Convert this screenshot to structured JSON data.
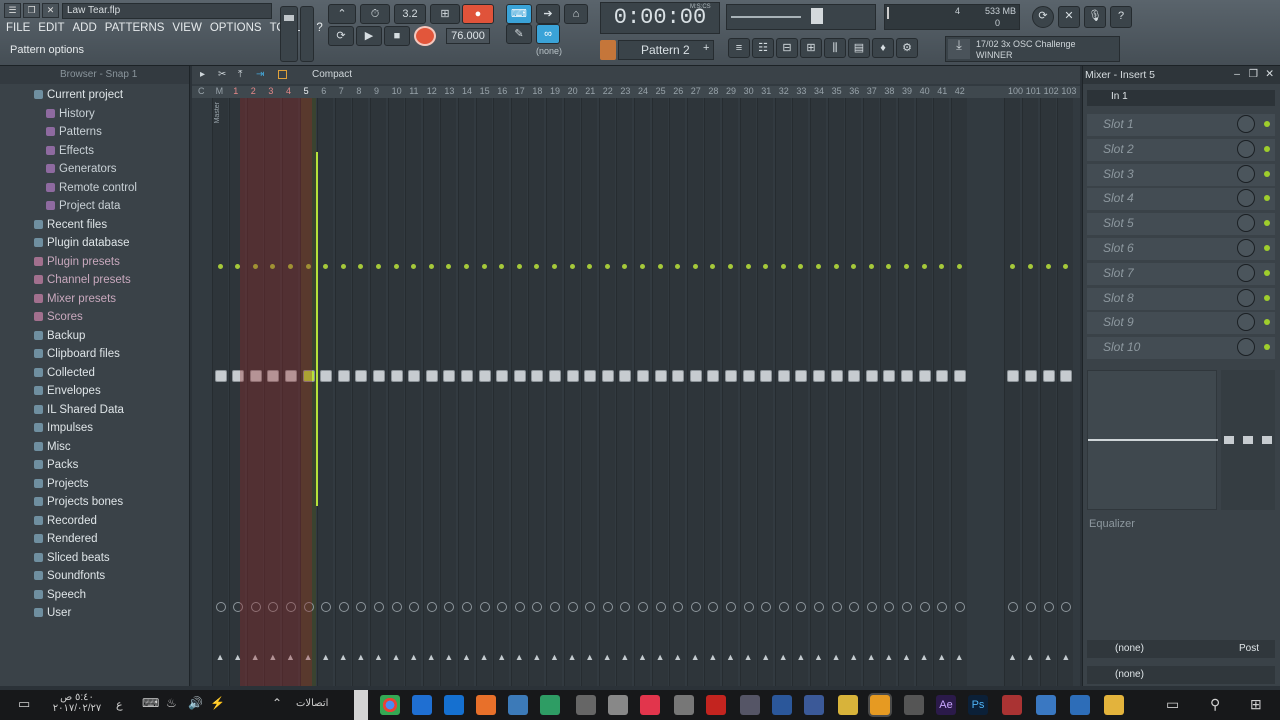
{
  "window": {
    "title": "Law Tear.flp",
    "hint": "Pattern options"
  },
  "menu": [
    "FILE",
    "EDIT",
    "ADD",
    "PATTERNS",
    "VIEW",
    "OPTIONS",
    "TOOLS",
    "?"
  ],
  "transport": {
    "time": "0:00:00",
    "time_unit": "M:S:CS",
    "tempo": "76.000",
    "snap": "(none)",
    "pattern": "Pattern 2",
    "mem": "533 MB",
    "mem_count": "4",
    "mem_sub": "0",
    "pat_prefix": "3.2"
  },
  "news": {
    "line1": "17/02  3x OSC Challenge",
    "line2": "WINNER"
  },
  "browser": {
    "header": "Browser - Snap 1",
    "items": [
      {
        "label": "Current project",
        "kind": "top"
      },
      {
        "label": "History",
        "kind": "sub"
      },
      {
        "label": "Patterns",
        "kind": "sub"
      },
      {
        "label": "Effects",
        "kind": "sub"
      },
      {
        "label": "Generators",
        "kind": "sub"
      },
      {
        "label": "Remote control",
        "kind": "sub"
      },
      {
        "label": "Project data",
        "kind": "sub"
      },
      {
        "label": "Recent files",
        "kind": "top"
      },
      {
        "label": "Plugin database",
        "kind": "top"
      },
      {
        "label": "Plugin presets",
        "kind": "pink"
      },
      {
        "label": "Channel presets",
        "kind": "pink"
      },
      {
        "label": "Mixer presets",
        "kind": "pink"
      },
      {
        "label": "Scores",
        "kind": "pink"
      },
      {
        "label": "Backup",
        "kind": "top"
      },
      {
        "label": "Clipboard files",
        "kind": "top"
      },
      {
        "label": "Collected",
        "kind": "top"
      },
      {
        "label": "Envelopes",
        "kind": "top"
      },
      {
        "label": "IL Shared Data",
        "kind": "top"
      },
      {
        "label": "Impulses",
        "kind": "top"
      },
      {
        "label": "Misc",
        "kind": "top"
      },
      {
        "label": "Packs",
        "kind": "top"
      },
      {
        "label": "Projects",
        "kind": "top"
      },
      {
        "label": "Projects bones",
        "kind": "top"
      },
      {
        "label": "Recorded",
        "kind": "top"
      },
      {
        "label": "Rendered",
        "kind": "top"
      },
      {
        "label": "Sliced beats",
        "kind": "top"
      },
      {
        "label": "Soundfonts",
        "kind": "top"
      },
      {
        "label": "Speech",
        "kind": "top"
      },
      {
        "label": "User",
        "kind": "top"
      }
    ]
  },
  "mixer": {
    "view": "Compact",
    "master": "Master",
    "numbers": [
      "C",
      "M",
      "1",
      "2",
      "3",
      "4",
      "5",
      "6",
      "7",
      "8",
      "9",
      "10",
      "11",
      "12",
      "13",
      "14",
      "15",
      "16",
      "17",
      "18",
      "19",
      "20",
      "21",
      "22",
      "23",
      "24",
      "25",
      "26",
      "27",
      "28",
      "29",
      "30",
      "31",
      "32",
      "33",
      "34",
      "35",
      "36",
      "37",
      "38",
      "39",
      "40",
      "41",
      "42",
      "100",
      "101",
      "102",
      "103"
    ],
    "selected": "5"
  },
  "insert": {
    "title": "Mixer - Insert 5",
    "input": "In 1",
    "slots": [
      "Slot 1",
      "Slot 2",
      "Slot 3",
      "Slot 4",
      "Slot 5",
      "Slot 6",
      "Slot 7",
      "Slot 8",
      "Slot 9",
      "Slot 10"
    ],
    "eq": "Equalizer",
    "out1": "(none)",
    "out2": "(none)",
    "post": "Post"
  },
  "taskbar": {
    "time": "٥:٤٠ ص",
    "date": "٢٠١٧/٠٢/٢٧",
    "lang": "ع",
    "connections": "اتصالات"
  }
}
